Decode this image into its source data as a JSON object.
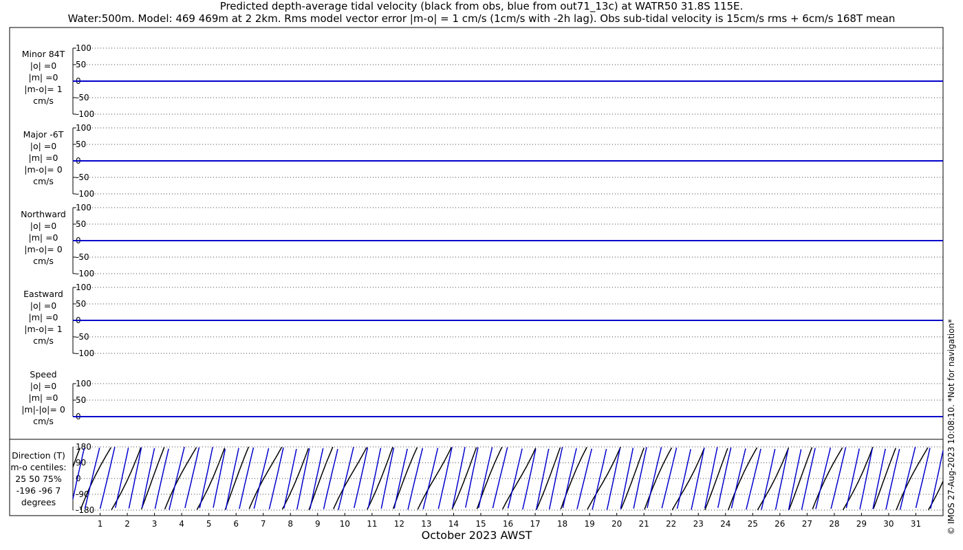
{
  "title_lines": [
    "Predicted depth-average tidal velocity (black from obs, blue from out71_13c) at WATR50 31.8S 115E.",
    "Water:500m. Model: 469 469m at 2 2km. Rms model vector error |m-o| = 1 cm/s (1cm/s with -2h lag). Obs sub-tidal velocity is 15cm/s rms + 6cm/s 168T mean"
  ],
  "credit": "© IMOS 27-Aug-2023 10:08:10. *Not for navigation*",
  "colors": {
    "obs": "#000000",
    "model": "#0000cc",
    "grid": "#000000"
  },
  "chart_data": {
    "type": "line",
    "xlabel": "October 2023 AWST",
    "x_ticks": [
      "1",
      "2",
      "3",
      "4",
      "5",
      "6",
      "7",
      "8",
      "9",
      "10",
      "11",
      "12",
      "13",
      "14",
      "15",
      "16",
      "17",
      "18",
      "19",
      "20",
      "21",
      "22",
      "23",
      "24",
      "25",
      "26",
      "27",
      "28",
      "29",
      "30",
      "31"
    ],
    "xlim": [
      0,
      32
    ],
    "series_legend": {
      "obs": "black from obs",
      "model": "blue from out71_13c"
    },
    "panels": [
      {
        "id": "minor",
        "labels": [
          "Minor 84T",
          "|o| =0",
          "|m| =0",
          "|m-o|= 1",
          "cm/s"
        ],
        "ylim": [
          -100,
          100
        ],
        "yticks": [
          "100",
          "50",
          "0",
          "-50",
          "-100"
        ],
        "tick_values": [
          100,
          50,
          0,
          -50,
          -100
        ],
        "obs_value": 0,
        "model_value": 0
      },
      {
        "id": "major",
        "labels": [
          "Major -6T",
          "|o| =0",
          "|m| =0",
          "|m-o|= 0",
          "cm/s"
        ],
        "ylim": [
          -100,
          100
        ],
        "yticks": [
          "100",
          "50",
          "0",
          "-50",
          "-100"
        ],
        "tick_values": [
          100,
          50,
          0,
          -50,
          -100
        ],
        "obs_value": 0,
        "model_value": 0
      },
      {
        "id": "north",
        "labels": [
          "Northward",
          "|o| =0",
          "|m| =0",
          "|m-o|= 0",
          "cm/s"
        ],
        "ylim": [
          -100,
          100
        ],
        "yticks": [
          "100",
          "50",
          "0",
          "-50",
          "-100"
        ],
        "tick_values": [
          100,
          50,
          0,
          -50,
          -100
        ],
        "obs_value": 0,
        "model_value": 0
      },
      {
        "id": "east",
        "labels": [
          "Eastward",
          "|o| =0",
          "|m| =0",
          "|m-o|= 1",
          "cm/s"
        ],
        "ylim": [
          -100,
          100
        ],
        "yticks": [
          "100",
          "50",
          "0",
          "-50",
          "-100"
        ],
        "tick_values": [
          100,
          50,
          0,
          -50,
          -100
        ],
        "obs_value": 0,
        "model_value": 0
      },
      {
        "id": "speed",
        "labels": [
          "Speed",
          "|o| =0",
          "|m| =0",
          "|m|-|o|= 0",
          "cm/s"
        ],
        "ylim": [
          0,
          100
        ],
        "yticks": [
          "100",
          "50",
          "0"
        ],
        "tick_values": [
          100,
          50,
          0
        ],
        "obs_value": 0,
        "model_value": 0
      }
    ],
    "direction_panel": {
      "labels": [
        "Direction (T)",
        "m-o centiles:",
        "25  50  75%",
        "-196  -96    7",
        "degrees"
      ],
      "ylim": [
        -180,
        180
      ],
      "yticks": [
        "180",
        "90",
        "0",
        "-90",
        "-180"
      ],
      "tick_values": [
        180,
        90,
        0,
        -90,
        -180
      ],
      "obs_period_days": 1.035,
      "model_period_days": 0.517,
      "obs_phase": 0.3,
      "model_phase": 1.2
    }
  }
}
